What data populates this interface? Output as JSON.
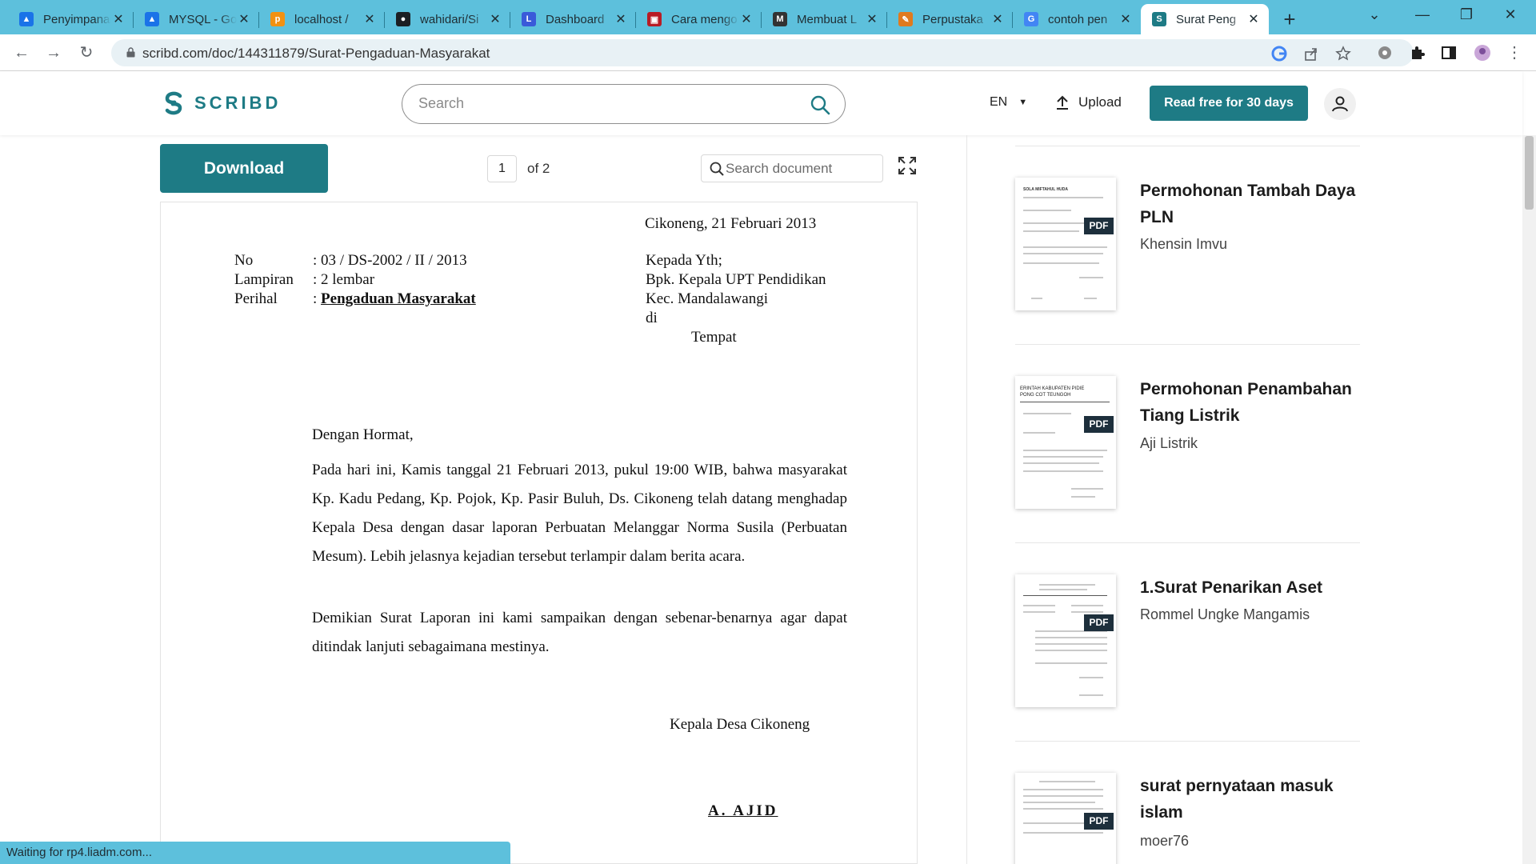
{
  "browser": {
    "tabs": [
      {
        "title": "Penyimpanan",
        "favicon_color": "#1a73e8",
        "favicon_char": "▲"
      },
      {
        "title": "MYSQL - Go",
        "favicon_color": "#1a73e8",
        "favicon_char": "▲"
      },
      {
        "title": "localhost / ",
        "favicon_color": "#f29111",
        "favicon_char": "p"
      },
      {
        "title": "wahidari/Si",
        "favicon_color": "#1b1f23",
        "favicon_char": "●"
      },
      {
        "title": "Dashboard",
        "favicon_color": "#3a5ad9",
        "favicon_char": "L"
      },
      {
        "title": "Cara mengo",
        "favicon_color": "#b81c25",
        "favicon_char": "▣"
      },
      {
        "title": "Membuat L",
        "favicon_color": "#333333",
        "favicon_char": "M"
      },
      {
        "title": "Perpustaka",
        "favicon_color": "#e07a1e",
        "favicon_char": "✎"
      },
      {
        "title": "contoh pen",
        "favicon_color": "#4285f4",
        "favicon_char": "G"
      },
      {
        "title": "Surat Peng",
        "favicon_color": "#1e7b85",
        "favicon_char": "S",
        "active": true
      }
    ],
    "url": "scribd.com/doc/144311879/Surat-Pengaduan-Masyarakat",
    "status": "Waiting for rp4.liadm.com..."
  },
  "header": {
    "logo": "SCRIBD",
    "search_placeholder": "Search",
    "language": "EN",
    "upload": "Upload",
    "cta": "Read free for 30 days"
  },
  "viewer": {
    "download": "Download",
    "current_page": "1",
    "page_total": "of 2",
    "search_placeholder": "Search document"
  },
  "document": {
    "date": "Cikoneng, 21 Februari 2013",
    "meta": [
      {
        "key": "No",
        "value": ": 03 / DS-2002 / II / 2013"
      },
      {
        "key": "Lampiran",
        "value": ": 2 lembar"
      },
      {
        "key": "Perihal",
        "value_prefix": ": ",
        "value": "Pengaduan Masyarakat"
      }
    ],
    "recipient": [
      "Kepada Yth;",
      "Bpk. Kepala UPT Pendidikan",
      "Kec. Mandalawangi",
      "di",
      "Tempat"
    ],
    "greeting": "Dengan Hormat,",
    "paragraph1": "Pada hari ini, Kamis tanggal 21 Februari 2013, pukul 19:00 WIB, bahwa masyarakat Kp. Kadu Pedang, Kp. Pojok, Kp. Pasir Buluh, Ds. Cikoneng telah datang menghadap Kepala Desa dengan dasar laporan Perbuatan Melanggar Norma Susila (Perbuatan Mesum). Lebih jelasnya kejadian tersebut terlampir dalam berita acara.",
    "paragraph2": "Demikian Surat Laporan ini kami sampaikan dengan sebenar-benarnya agar dapat ditindak lanjuti sebagaimana mestinya.",
    "signer_title": "Kepala Desa Cikoneng",
    "signer_name": "A. AJID"
  },
  "recommendations": [
    {
      "title": "Permohonan Tambah Daya PLN",
      "author": "Khensin Imvu",
      "badge": "PDF",
      "thumb_heading": "SOLA MIFTAHUL HUDA"
    },
    {
      "title": "Permohonan Penambahan Tiang Listrik",
      "author": "Aji Listrik",
      "badge": "PDF",
      "thumb_heading": "ERINTAH KABUPATEN PIDIE\nPONG COT TEUNGOH"
    },
    {
      "title": "1.Surat Penarikan Aset",
      "author": "Rommel Ungke Mangamis",
      "badge": "PDF",
      "thumb_heading": ""
    },
    {
      "title": "surat pernyataan masuk islam",
      "author": "moer76",
      "badge": "PDF",
      "thumb_heading": ""
    }
  ]
}
